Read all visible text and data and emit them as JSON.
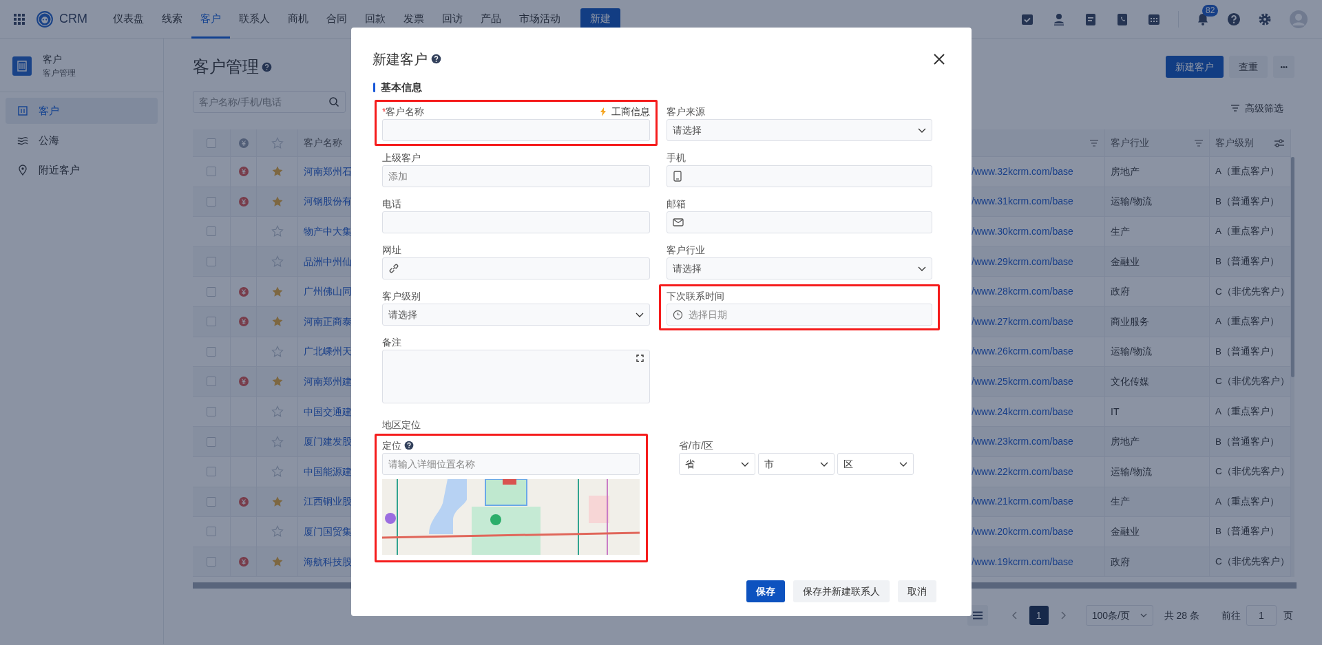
{
  "navbar": {
    "brand": "CRM",
    "menu_items": [
      {
        "label": "仪表盘",
        "selected": false
      },
      {
        "label": "线索",
        "selected": false
      },
      {
        "label": "客户",
        "selected": true
      },
      {
        "label": "联系人",
        "selected": false
      },
      {
        "label": "商机",
        "selected": false
      },
      {
        "label": "合同",
        "selected": false
      },
      {
        "label": "回款",
        "selected": false
      },
      {
        "label": "发票",
        "selected": false
      },
      {
        "label": "回访",
        "selected": false
      },
      {
        "label": "产品",
        "selected": false
      },
      {
        "label": "市场活动",
        "selected": false
      }
    ],
    "new_button": "新建",
    "notification_count": "82"
  },
  "sidebar": {
    "title": "客户",
    "subtitle": "客户管理",
    "items": [
      {
        "label": "客户",
        "selected": true
      },
      {
        "label": "公海",
        "selected": false
      },
      {
        "label": "附近客户",
        "selected": false
      }
    ]
  },
  "page": {
    "title": "客户管理",
    "buttons": [
      {
        "label": "新建客户",
        "kind": "primary"
      },
      {
        "label": "查重",
        "kind": "secondary"
      },
      {
        "label": "•••",
        "kind": "more"
      }
    ],
    "search": {
      "placeholder": "客户名称/手机/电话"
    },
    "advanced_filter": "高级筛选"
  },
  "table": {
    "select_all_checked": false,
    "columns": [
      {
        "label": "客户名称",
        "filter": false
      },
      {
        "label": "客户行业",
        "filter": true
      },
      {
        "label": "客户级别",
        "filter": false
      }
    ],
    "rows": [
      {
        "checked": false,
        "deal": true,
        "starred": true,
        "name": "河南郑州石",
        "website": "/www.32kcrm.com/base",
        "industry": "房地产",
        "level": "A（重点客户）"
      },
      {
        "checked": false,
        "deal": true,
        "starred": true,
        "name": "河钢股份有",
        "website": "/www.31kcrm.com/base",
        "industry": "运输/物流",
        "level": "B（普通客户）"
      },
      {
        "checked": false,
        "deal": false,
        "starred": false,
        "name": "物产中大集",
        "website": "/www.30kcrm.com/base",
        "industry": "生产",
        "level": "A（重点客户）"
      },
      {
        "checked": false,
        "deal": false,
        "starred": false,
        "name": "品洲中州仙",
        "website": "/www.29kcrm.com/base",
        "industry": "金融业",
        "level": "B（普通客户）"
      },
      {
        "checked": false,
        "deal": true,
        "starred": true,
        "name": "广州佛山同",
        "website": "/www.28kcrm.com/base",
        "industry": "政府",
        "level": "C（非优先客户）"
      },
      {
        "checked": false,
        "deal": true,
        "starred": true,
        "name": "河南正商泰",
        "website": "/www.27kcrm.com/base",
        "industry": "商业服务",
        "level": "A（重点客户）"
      },
      {
        "checked": false,
        "deal": false,
        "starred": false,
        "name": "广北嵊州天",
        "website": "/www.26kcrm.com/base",
        "industry": "运输/物流",
        "level": "B（普通客户）"
      },
      {
        "checked": false,
        "deal": true,
        "starred": true,
        "name": "河南郑州建",
        "website": "/www.25kcrm.com/base",
        "industry": "文化传媒",
        "level": "C（非优先客户）"
      },
      {
        "checked": false,
        "deal": false,
        "starred": false,
        "name": "中国交通建",
        "website": "/www.24kcrm.com/base",
        "industry": "IT",
        "level": "A（重点客户）"
      },
      {
        "checked": false,
        "deal": false,
        "starred": false,
        "name": "厦门建发股",
        "website": "/www.23kcrm.com/base",
        "industry": "房地产",
        "level": "B（普通客户）"
      },
      {
        "checked": false,
        "deal": false,
        "starred": false,
        "name": "中国能源建",
        "website": "/www.22kcrm.com/base",
        "industry": "运输/物流",
        "level": "C（非优先客户）"
      },
      {
        "checked": false,
        "deal": true,
        "starred": true,
        "name": "江西铜业股",
        "website": "/www.21kcrm.com/base",
        "industry": "生产",
        "level": "A（重点客户）"
      },
      {
        "checked": false,
        "deal": false,
        "starred": false,
        "name": "厦门国贸集",
        "website": "/www.20kcrm.com/base",
        "industry": "金融业",
        "level": "B（普通客户）"
      },
      {
        "checked": false,
        "deal": true,
        "starred": true,
        "name": "海航科技股",
        "website": "/www.19kcrm.com/base",
        "industry": "政府",
        "level": "C（非优先客户）"
      }
    ]
  },
  "pagination": {
    "current_page": "1",
    "page_size": "100条/页",
    "total": "共 28 条",
    "goto_label": "前往",
    "goto_value": "1",
    "goto_suffix": "页"
  },
  "modal": {
    "title": "新建客户",
    "section": "基本信息",
    "business_info_link": "工商信息",
    "fields": [
      {
        "kind": "text",
        "label": "客户名称",
        "required_mark": "*",
        "highlighted": true
      },
      {
        "kind": "select",
        "label": "客户来源",
        "placeholder": "请选择",
        "highlighted": false
      },
      {
        "kind": "text",
        "label": "上级客户",
        "placeholder": "添加",
        "highlighted": false
      },
      {
        "kind": "mobile",
        "label": "手机",
        "highlighted": false
      },
      {
        "kind": "text",
        "label": "电话",
        "highlighted": false
      },
      {
        "kind": "email",
        "label": "邮箱",
        "highlighted": false
      },
      {
        "kind": "url",
        "label": "网址",
        "highlighted": false
      },
      {
        "kind": "select",
        "label": "客户行业",
        "placeholder": "请选择",
        "highlighted": false
      },
      {
        "kind": "select",
        "label": "客户级别",
        "placeholder": "请选择",
        "highlighted": false
      },
      {
        "kind": "date",
        "label": "下次联系时间",
        "placeholder": "选择日期",
        "highlighted": true
      },
      {
        "kind": "textarea",
        "label": "备注",
        "highlighted": false
      }
    ],
    "region_section": "地区定位",
    "location": {
      "label": "定位",
      "placeholder": "请输入详细位置名称",
      "highlighted": true
    },
    "region": {
      "label": "省/市/区",
      "selects": [
        "省",
        "市",
        "区"
      ]
    },
    "buttons": [
      {
        "label": "保存",
        "kind": "primary"
      },
      {
        "label": "保存并新建联系人",
        "kind": "secondary"
      },
      {
        "label": "取消",
        "kind": "secondary"
      }
    ]
  }
}
